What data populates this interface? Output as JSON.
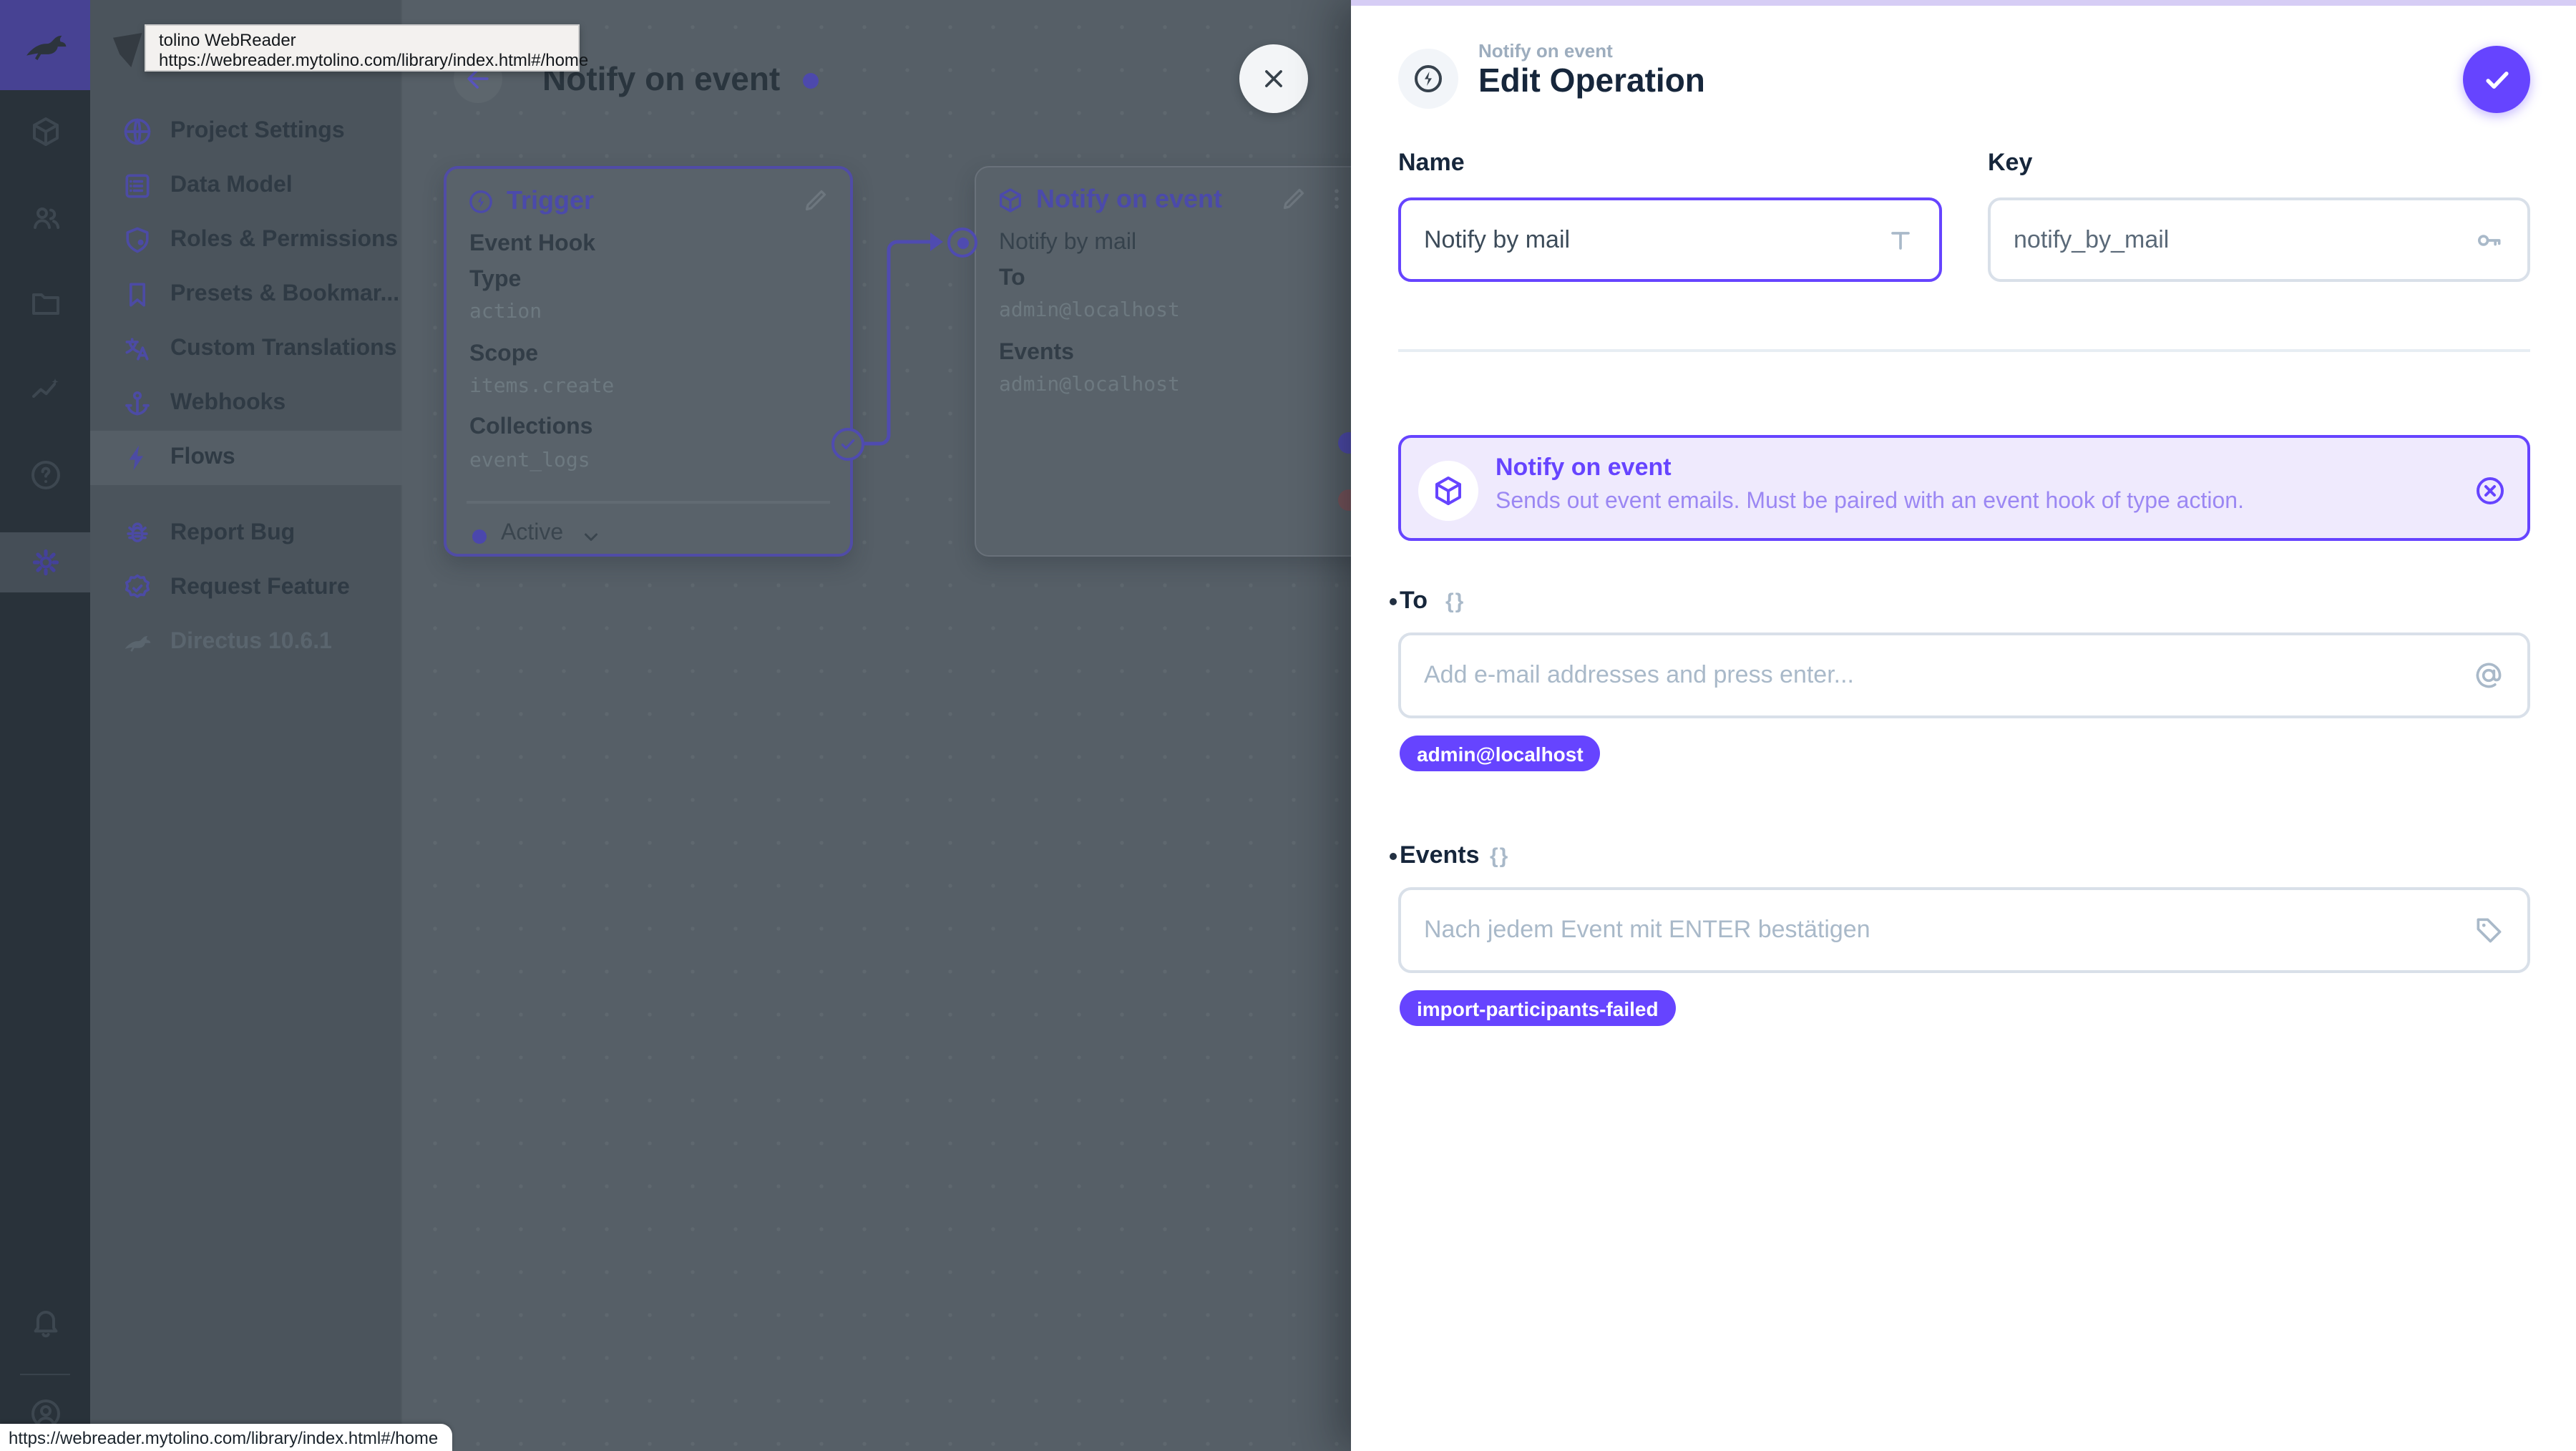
{
  "tooltip": {
    "title": "tolino WebReader",
    "url": "https://webreader.mytolino.com/library/index.html#/home"
  },
  "status_bar": {
    "url": "https://webreader.mytolino.com/library/index.html#/home"
  },
  "sidebar": {
    "items": [
      {
        "label": "Project Settings",
        "icon": "globe-icon"
      },
      {
        "label": "Data Model",
        "icon": "data-model-icon"
      },
      {
        "label": "Roles & Permissions",
        "icon": "shield-icon"
      },
      {
        "label": "Presets & Bookmar...",
        "icon": "bookmark-icon"
      },
      {
        "label": "Custom Translations",
        "icon": "translate-icon"
      },
      {
        "label": "Webhooks",
        "icon": "anchor-icon"
      },
      {
        "label": "Flows",
        "icon": "bolt-icon"
      }
    ],
    "footer_items": [
      {
        "label": "Report Bug",
        "icon": "bug-icon"
      },
      {
        "label": "Request Feature",
        "icon": "badge-check-icon"
      }
    ],
    "version": "Directus 10.6.1"
  },
  "flow": {
    "title": "Notify on event",
    "trigger": {
      "title": "Trigger",
      "row1_label": "Event Hook",
      "row2_label": "Type",
      "row2_value": "action",
      "row3_label": "Scope",
      "row3_value": "items.create",
      "row4_label": "Collections",
      "row4_value": "event_logs",
      "status": "Active"
    },
    "operation": {
      "title": "Notify on event",
      "name": "Notify by mail",
      "to_label": "To",
      "to_value": "admin@localhost",
      "events_label": "Events",
      "events_value": "admin@localhost"
    }
  },
  "drawer": {
    "breadcrumb": "Notify on event",
    "title": "Edit Operation",
    "name_field": {
      "label": "Name",
      "value": "Notify by mail"
    },
    "key_field": {
      "label": "Key",
      "value": "notify_by_mail"
    },
    "notice": {
      "title": "Notify on event",
      "description": "Sends out event emails. Must be paired with an event hook of type action."
    },
    "to_field": {
      "label": "To",
      "placeholder": "Add e-mail addresses and press enter...",
      "braces": "{}",
      "chips": [
        "admin@localhost"
      ]
    },
    "events_field": {
      "label": "Events",
      "placeholder": "Nach jedem Event mit ENTER bestätigen",
      "braces": "{}",
      "chips": [
        "import-participants-failed"
      ]
    }
  },
  "colors": {
    "accent": "#6644ff",
    "accent_light": "#efeafd"
  }
}
